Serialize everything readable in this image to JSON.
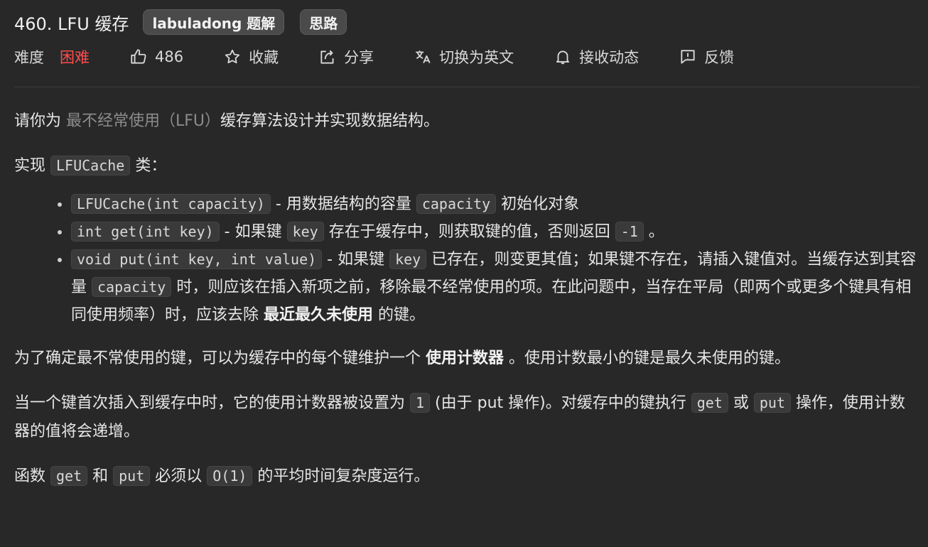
{
  "header": {
    "title": "460. LFU 缓存",
    "tag1": "labuladong 题解",
    "tag2": "思路"
  },
  "meta": {
    "difficulty_label": "难度",
    "difficulty_value": "困难",
    "difficulty_color": "#ff4c4c",
    "likes": "486",
    "favorite": "收藏",
    "share": "分享",
    "translate": "切换为英文",
    "subscribe": "接收动态",
    "feedback": "反馈",
    "icons": [
      "thumbs-up-icon",
      "star-icon",
      "share-icon",
      "translate-icon",
      "bell-icon",
      "feedback-icon"
    ]
  },
  "content": {
    "p1_a": "请你为 ",
    "p1_link": "最不经常使用（LFU）",
    "p1_b": "缓存算法设计并实现数据结构。",
    "p2_a": "实现 ",
    "p2_code": "LFUCache",
    "p2_b": " 类：",
    "b1_code": "LFUCache(int capacity)",
    "b1_a": " - 用数据结构的容量 ",
    "b1_code2": "capacity",
    "b1_b": " 初始化对象",
    "b2_code": "int get(int key)",
    "b2_a": " - 如果键 ",
    "b2_code2": "key",
    "b2_b": " 存在于缓存中，则获取键的值，否则返回 ",
    "b2_code3": "-1",
    "b2_c": " 。",
    "b3_code": "void put(int key, int value)",
    "b3_a": " - 如果键 ",
    "b3_code2": "key",
    "b3_b": " 已存在，则变更其值；如果键不存在，请插入键值对。当缓存达到其容量 ",
    "b3_code3": "capacity",
    "b3_c": " 时，则应该在插入新项之前，移除最不经常使用的项。在此问题中，当存在平局（即两个或更多个键具有相同使用频率）时，应该去除 ",
    "b3_bold": "最近最久未使用",
    "b3_d": " 的键。",
    "p3_a": "为了确定最不常使用的键，可以为缓存中的每个键维护一个 ",
    "p3_bold": "使用计数器",
    "p3_b": " 。使用计数最小的键是最久未使用的键。",
    "p4_a": "当一个键首次插入到缓存中时，它的使用计数器被设置为 ",
    "p4_code": "1",
    "p4_b": " (由于 put 操作)。对缓存中的键执行 ",
    "p4_code2": "get",
    "p4_c": " 或 ",
    "p4_code3": "put",
    "p4_d": " 操作，使用计数器的值将会递增。",
    "p5_a": "函数 ",
    "p5_code": "get",
    "p5_b": " 和 ",
    "p5_code2": "put",
    "p5_c": " 必须以 ",
    "p5_code3": "O(1)",
    "p5_d": " 的平均时间复杂度运行。"
  }
}
